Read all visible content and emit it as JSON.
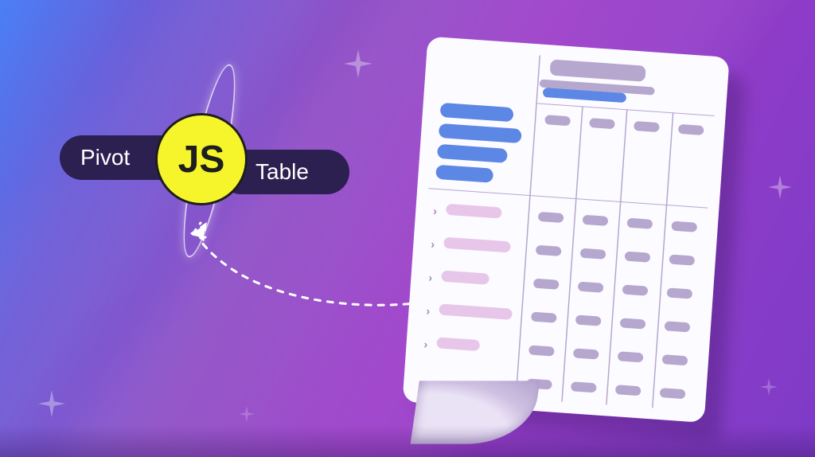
{
  "badge": {
    "left_label": "Pivot",
    "js_label": "JS",
    "right_label": "Table"
  },
  "illustration": {
    "description": "Stylized pivot-table document with blue header pills, expandable pink row groups, and grey data cells connected by a dashed arrow to a JS badge",
    "header_blue_pills": 4,
    "row_groups": 5,
    "data_columns": 4
  },
  "icons": {
    "sparkle": "sparkle-icon",
    "chevron": "chevron-right-icon",
    "arrow": "dashed-arrow-icon",
    "orbit": "orbit-ring-icon",
    "js_badge": "js-badge-icon"
  },
  "colors": {
    "pill_bg": "#2c2050",
    "js_yellow": "#f6f52c",
    "doc_bg": "#fcfbff",
    "blue": "#5d87e4",
    "pink": "#e7c6ea",
    "grey": "#b6a7cf"
  }
}
